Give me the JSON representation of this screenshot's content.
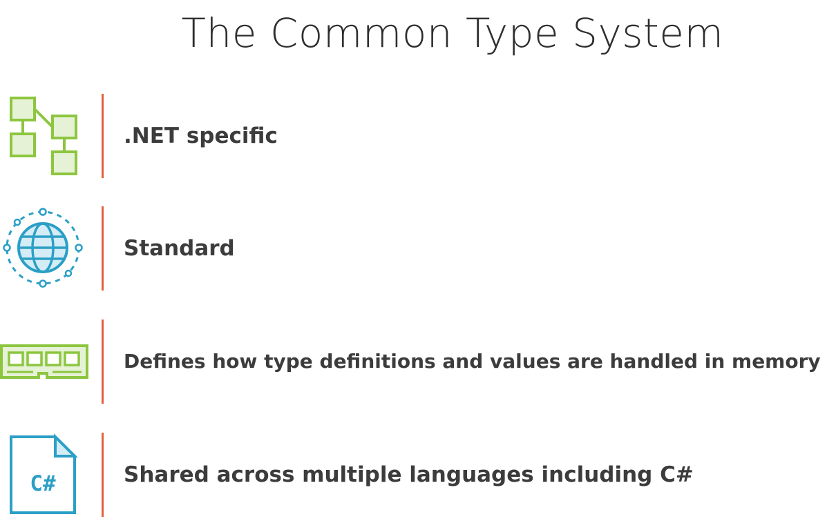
{
  "slide": {
    "title": "The Common Type System"
  },
  "items": [
    {
      "text": ".NET specific",
      "icon": "hierarchy-diagram-icon"
    },
    {
      "text": "Standard",
      "icon": "globe-network-icon"
    },
    {
      "text": "Defines how type definitions and values are handled in memory",
      "icon": "memory-module-icon"
    },
    {
      "text": "Shared across multiple languages including C#",
      "icon": "csharp-file-icon",
      "icon_label": "C#"
    }
  ],
  "colors": {
    "title": "#2e2e2e",
    "text": "#3c3c3c",
    "divider": "#e2603a",
    "green": "#8cc63f",
    "green_fill": "#e6f2d5",
    "blue": "#2b9fc6",
    "blue_fill": "#d4ecf5"
  }
}
